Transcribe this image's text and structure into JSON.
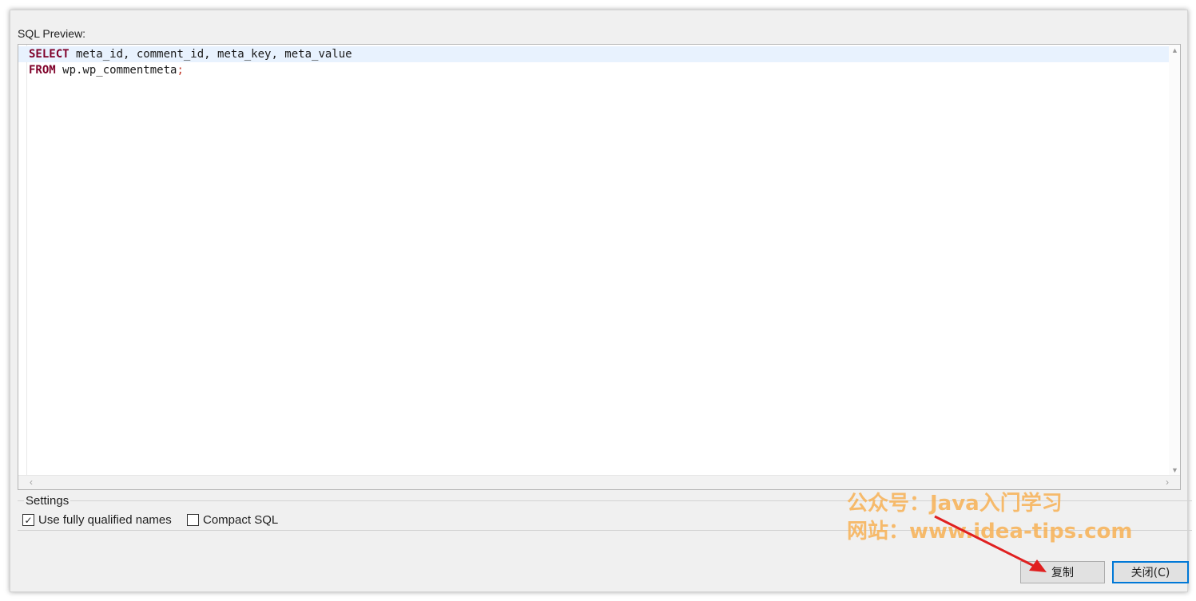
{
  "dialog": {
    "sql_preview_label": "SQL Preview:",
    "settings_label": "Settings"
  },
  "sql": {
    "line1": {
      "keyword": "SELECT",
      "text": " meta_id, comment_id, meta_key, meta_value"
    },
    "line2": {
      "keyword": "FROM",
      "text": " wp.wp_commentmeta",
      "terminator": ";"
    }
  },
  "settings": {
    "fully_qualified": {
      "label": "Use fully qualified names",
      "checked": true
    },
    "compact_sql": {
      "label": "Compact SQL",
      "checked": false
    }
  },
  "buttons": {
    "copy": "复制",
    "close": "关闭(C)"
  },
  "watermark": {
    "line1": "公众号：Java入门学习",
    "line2": "网站：www.idea-tips.com"
  },
  "colors": {
    "keyword": "#7f0029",
    "current_line": "#e8f2fe",
    "watermark": "#f7b053",
    "annotation_arrow": "#e02020",
    "default_button_border": "#0078d7"
  }
}
